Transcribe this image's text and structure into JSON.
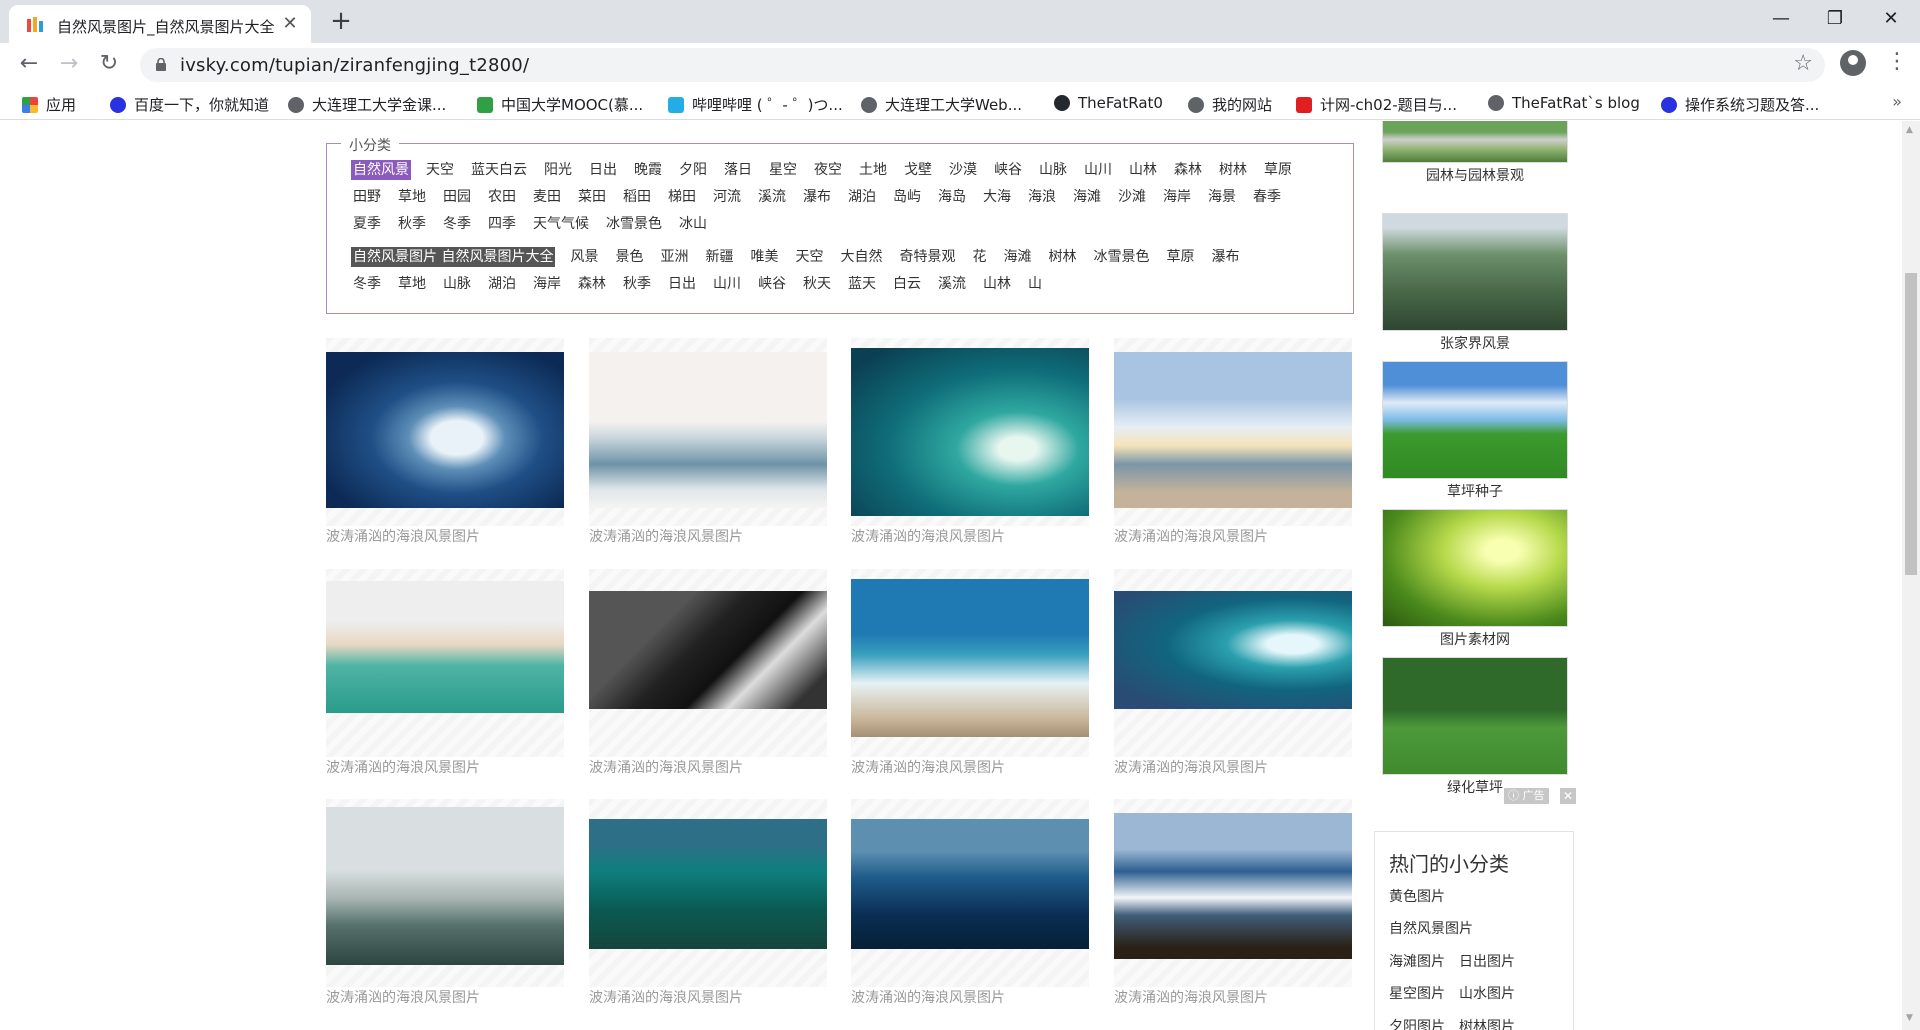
{
  "browser": {
    "tab_title": "自然风景图片_自然风景图片大全",
    "tab_close": "✕",
    "new_tab": "+",
    "url": "ivsky.com/tupian/ziranfengjing_t2800/",
    "window_minimize": "—",
    "window_restore": "❐",
    "window_close": "✕",
    "nav_back": "←",
    "nav_forward": "→",
    "nav_reload": "↻",
    "star": "☆",
    "menu": "⋮",
    "bookmarks_more": "»"
  },
  "bookmarks": [
    {
      "label": "应用",
      "icon": "apps-grid-icon",
      "color": "#e8453c"
    },
    {
      "label": "百度一下，你就知道",
      "icon": "baidu-paw-icon",
      "color": "#2932e1"
    },
    {
      "label": "大连理工大学金课...",
      "icon": "globe-icon",
      "color": "#5f6368"
    },
    {
      "label": "中国大学MOOC(慕...",
      "icon": "mooc-icon",
      "color": "#2fa043"
    },
    {
      "label": "哔哩哔哩 ( ゜- ゜)つ...",
      "icon": "bilibili-icon",
      "color": "#23ade5"
    },
    {
      "label": "大连理工大学Web...",
      "icon": "globe-icon",
      "color": "#5f6368"
    },
    {
      "label": "TheFatRat0",
      "icon": "github-icon",
      "color": "#24292e"
    },
    {
      "label": "我的网站",
      "icon": "globe-icon",
      "color": "#5f6368"
    },
    {
      "label": "计网-ch02-题目与...",
      "icon": "c-logo-icon",
      "color": "#e02020"
    },
    {
      "label": "TheFatRat`s blog",
      "icon": "globe-icon",
      "color": "#5f6368"
    },
    {
      "label": "操作系统习题及答...",
      "icon": "baidu-paw-icon",
      "color": "#2932e1"
    }
  ],
  "categories": {
    "legend": "小分类",
    "rows": [
      [
        "自然风景",
        "天空",
        "蓝天白云",
        "阳光",
        "日出",
        "晚霞",
        "夕阳",
        "落日",
        "星空",
        "夜空",
        "土地",
        "戈壁",
        "沙漠",
        "峡谷",
        "山脉",
        "山川",
        "山林",
        "森林",
        "树林",
        "草原"
      ],
      [
        "田野",
        "草地",
        "田园",
        "农田",
        "麦田",
        "菜田",
        "稻田",
        "梯田",
        "河流",
        "溪流",
        "瀑布",
        "湖泊",
        "岛屿",
        "海岛",
        "大海",
        "海浪",
        "海滩",
        "沙滩",
        "海岸",
        "海景",
        "春季"
      ],
      [
        "夏季",
        "秋季",
        "冬季",
        "四季",
        "天气气候",
        "冰雪景色",
        "冰山"
      ]
    ],
    "related_rows": [
      [
        "自然风景图片 自然风景图片大全",
        "风景",
        "景色",
        "亚洲",
        "新疆",
        "唯美",
        "天空",
        "大自然",
        "奇特景观",
        "花",
        "海滩",
        "树林",
        "冰雪景色",
        "草原",
        "瀑布"
      ],
      [
        "冬季",
        "草地",
        "山脉",
        "湖泊",
        "海岸",
        "森林",
        "秋季",
        "日出",
        "山川",
        "峡谷",
        "秋天",
        "蓝天",
        "白云",
        "溪流",
        "山林",
        "山"
      ]
    ]
  },
  "gallery": [
    {
      "caption": "波涛涌汹的海浪风景图片"
    },
    {
      "caption": "波涛涌汹的海浪风景图片"
    },
    {
      "caption": "波涛涌汹的海浪风景图片"
    },
    {
      "caption": "波涛涌汹的海浪风景图片"
    },
    {
      "caption": "波涛涌汹的海浪风景图片"
    },
    {
      "caption": "波涛涌汹的海浪风景图片"
    },
    {
      "caption": "波涛涌汹的海浪风景图片"
    },
    {
      "caption": "波涛涌汹的海浪风景图片"
    },
    {
      "caption": "波涛涌汹的海浪风景图片"
    },
    {
      "caption": "波涛涌汹的海浪风景图片"
    },
    {
      "caption": "波涛涌汹的海浪风景图片"
    },
    {
      "caption": "波涛涌汹的海浪风景图片"
    }
  ],
  "sidebar": {
    "items": [
      {
        "label": "园林与园林景观"
      },
      {
        "label": "张家界风景"
      },
      {
        "label": "草坪种子"
      },
      {
        "label": "图片素材网"
      },
      {
        "label": "绿化草坪"
      }
    ],
    "ad_label": "广告",
    "ad_close": "✕",
    "hot_title": "热门的小分类",
    "hot_rows": [
      [
        "黄色图片"
      ],
      [
        "自然风景图片"
      ],
      [
        "海滩图片",
        "日出图片"
      ],
      [
        "星空图片",
        "山水图片"
      ],
      [
        "夕阳图片",
        "树林图片"
      ]
    ]
  }
}
